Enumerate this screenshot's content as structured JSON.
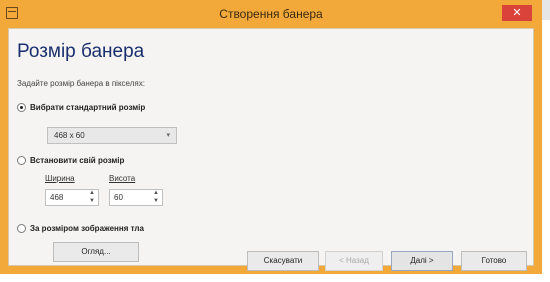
{
  "window": {
    "title": "Створення банера",
    "close_label": "✕"
  },
  "main": {
    "heading": "Розмір банера",
    "subtitle": "Задайте розмір банера в пікселях:",
    "options": [
      {
        "label": "Вибрати стандартний розмір",
        "checked": true
      },
      {
        "label": "Встановити свій розмір",
        "checked": false
      },
      {
        "label": "За розміром зображення тла",
        "checked": false
      }
    ],
    "standard_size": {
      "value": "468 x 60"
    },
    "custom": {
      "width_label": "Ширина",
      "height_label": "Висота",
      "width_value": "468",
      "height_value": "60"
    },
    "browse_label": "Огляд..."
  },
  "footer": {
    "cancel_label": "Скасувати",
    "back_label": "< Назад",
    "next_label": "Далі >",
    "finish_label": "Готово"
  },
  "icons": {
    "app": "app-icon",
    "close": "close-icon",
    "dropdown": "chevron-down-icon",
    "spinner": "spinner-arrows-icon"
  }
}
